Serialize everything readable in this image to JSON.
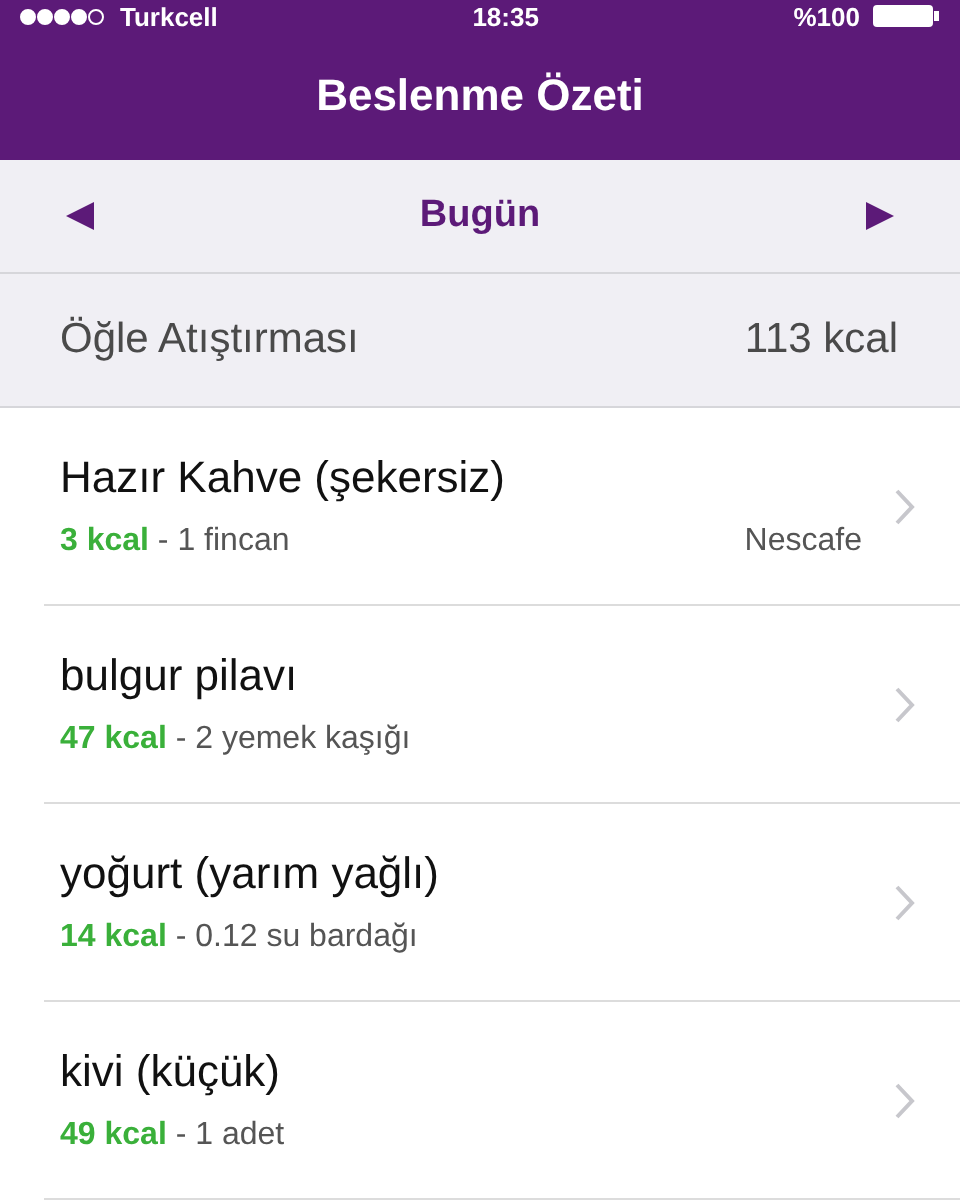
{
  "status_bar": {
    "signal_dots": [
      {
        "filled": true
      },
      {
        "filled": true
      },
      {
        "filled": true
      },
      {
        "filled": true
      },
      {
        "filled": false
      }
    ],
    "carrier": "Turkcell",
    "time": "18:35",
    "battery_text": "%100"
  },
  "nav_bar": {
    "title": "Beslenme Özeti"
  },
  "date_bar": {
    "label": "Bugün"
  },
  "section": {
    "title": "Öğle Atıştırması",
    "total": "113 kcal"
  },
  "items": [
    {
      "name": "Hazır Kahve (şekersiz)",
      "kcal": "3 kcal",
      "portion": " - 1 fincan",
      "brand": "Nescafe"
    },
    {
      "name": "bulgur pilavı",
      "kcal": "47 kcal",
      "portion": " - 2 yemek kaşığı"
    },
    {
      "name": "yoğurt (yarım yağlı)",
      "kcal": "14 kcal",
      "portion": " - 0.12 su bardağı"
    },
    {
      "name": "kivi (küçük)",
      "kcal": "49 kcal",
      "portion": " - 1 adet"
    }
  ]
}
